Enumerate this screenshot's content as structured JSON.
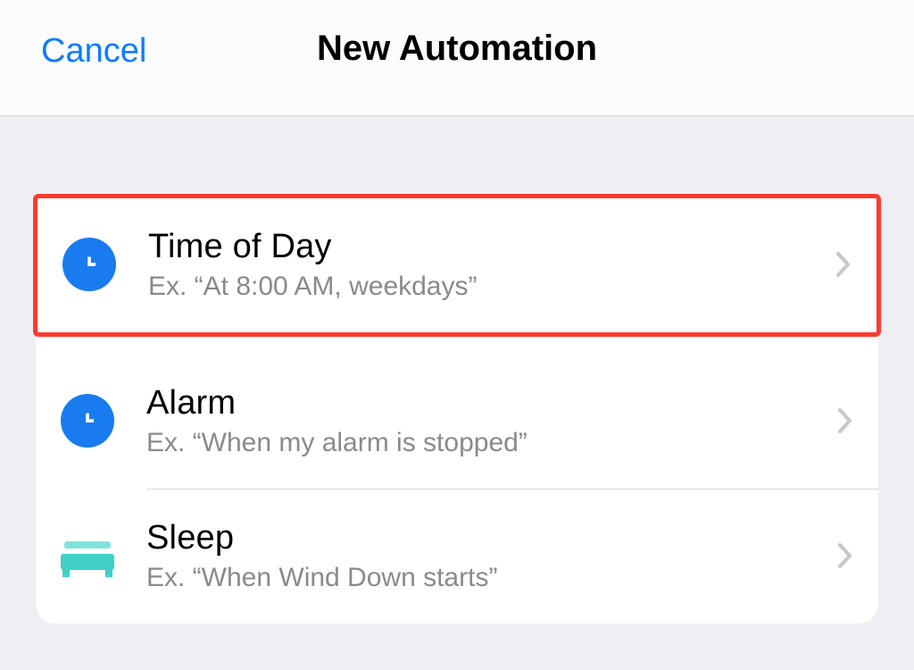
{
  "navbar": {
    "cancel_label": "Cancel",
    "title": "New Automation"
  },
  "list": {
    "items": [
      {
        "icon": "clock-icon",
        "title": "Time of Day",
        "subtitle": "Ex. “At 8:00 AM, weekdays”",
        "highlighted": true
      },
      {
        "icon": "clock-icon",
        "title": "Alarm",
        "subtitle": "Ex. “When my alarm is stopped”",
        "highlighted": false
      },
      {
        "icon": "bed-icon",
        "title": "Sleep",
        "subtitle": "Ex. “When Wind Down starts”",
        "highlighted": false
      }
    ]
  },
  "colors": {
    "accent_blue": "#0a7dff",
    "icon_blue": "#187bef",
    "icon_teal": "#40cfc6",
    "highlight_red": "#ff3b2f",
    "secondary_text": "#8a8a8e",
    "separator": "#d8d8da"
  }
}
